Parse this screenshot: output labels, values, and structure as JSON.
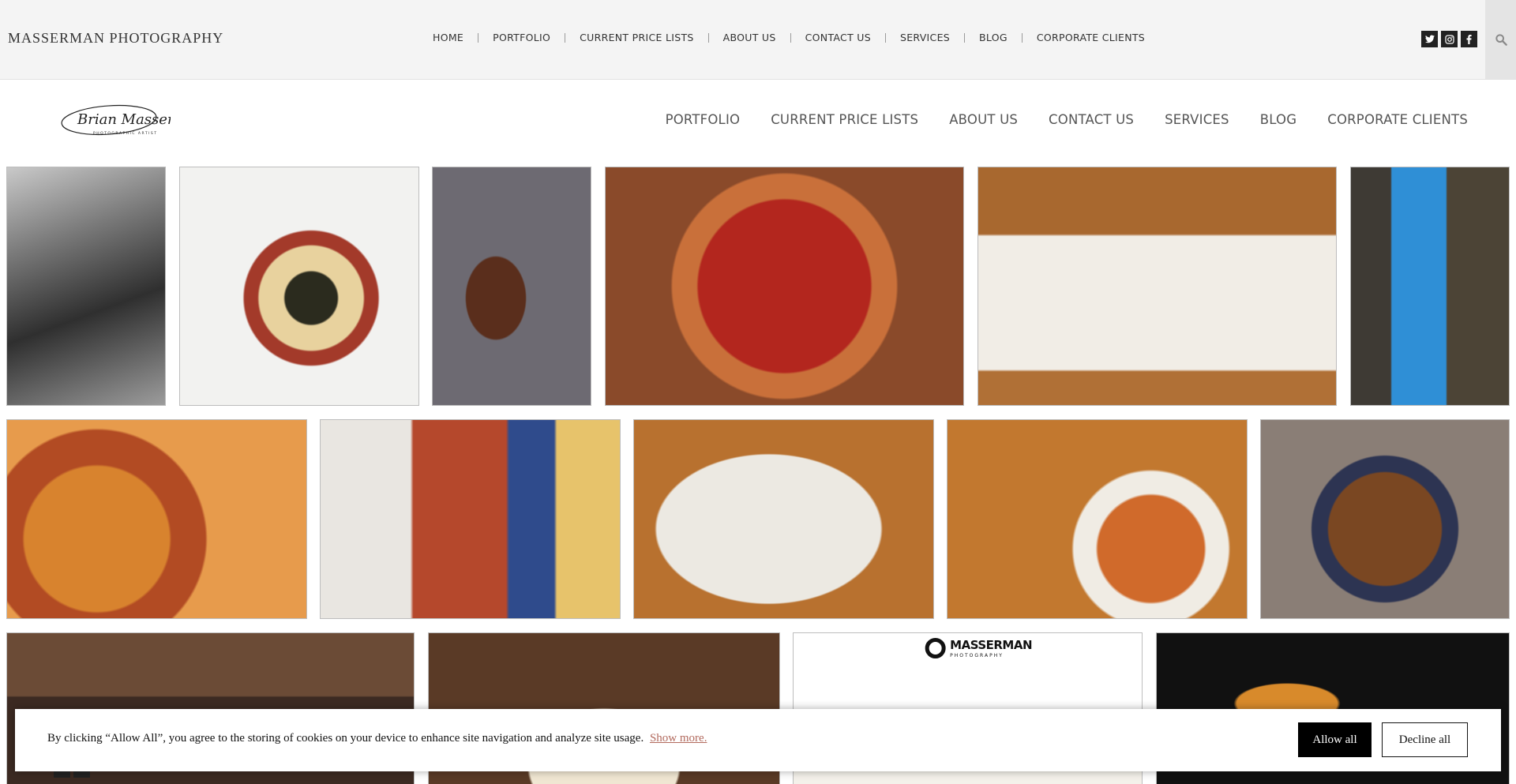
{
  "topbar": {
    "site_title": "MASSERMAN PHOTOGRAPHY",
    "nav": [
      "HOME",
      "PORTFOLIO",
      "CURRENT PRICE LISTS",
      "ABOUT US",
      "CONTACT US",
      "SERVICES",
      "BLOG",
      "CORPORATE CLIENTS"
    ],
    "socials": [
      {
        "icon": "twitter-icon",
        "glyph": "t"
      },
      {
        "icon": "instagram-icon",
        "glyph": "◻"
      },
      {
        "icon": "facebook-icon",
        "glyph": "f"
      }
    ],
    "search_icon": "search-icon"
  },
  "header": {
    "logo_script": "Brian Masserman",
    "logo_sub": "PHOTOGRAPHIC ARTIST",
    "nav": [
      "PORTFOLIO",
      "CURRENT PRICE LISTS",
      "ABOUT US",
      "CONTACT US",
      "SERVICES",
      "BLOG",
      "CORPORATE CLIENTS"
    ]
  },
  "gallery": [
    {
      "name": "photo-portrait-dreadlocks",
      "bg": "linear-gradient(160deg,#c9c9c9 0%,#7a7a7a 30%,#2f2f2f 60%,#9c9c9c 100%)"
    },
    {
      "name": "photo-plated-beet-dish",
      "bg": "radial-gradient(circle at 55% 55%,#2b2b1e 0 14%,#e8d29e 15% 28%,#a33a2a 29% 36%,#f2f2f0 37% 100%)"
    },
    {
      "name": "photo-tomahawk-steak",
      "bg": "radial-gradient(ellipse at 40% 55%,#5a2e1c 0 22%,#6d6a72 23% 100%)"
    },
    {
      "name": "photo-pizza-topdown",
      "bg": "radial-gradient(circle at 50% 50%,#b3261e 0 40%,#c9703a 41% 52%,#8a4a2a 53% 100%)"
    },
    {
      "name": "photo-salmon-plate",
      "bg": "linear-gradient(180deg,#a8682f 0 28%,#f1ede6 29% 85%,#b07036 86% 100%)"
    },
    {
      "name": "photo-pontoon-ale-can",
      "bg": "linear-gradient(90deg,#3e3a34 0 25%,#2f8fd6 26% 60%,#4c4436 61% 100%)"
    },
    {
      "name": "photo-two-pizzas-salad",
      "bg": "radial-gradient(circle at 30% 60%,#d8832e 0 30%,#b24b23 31% 45%,#e79b4c 46% 100%)"
    },
    {
      "name": "photo-fish-tacos-chips",
      "bg": "linear-gradient(90deg,#e9e6e1 0 30%,#b5482c 31% 62%,#2f4b8c 63% 78%,#e7c36b 79% 100%)"
    },
    {
      "name": "photo-tacos-rice",
      "bg": "radial-gradient(ellipse at 45% 55%,#ece9e2 0 48%,#b8712f 49% 100%)"
    },
    {
      "name": "photo-shrimp-pasta-spread",
      "bg": "radial-gradient(circle at 68% 65%,#d06a2b 0 22%,#f0ece4 23% 32%,#c2782f 33% 100%)"
    },
    {
      "name": "photo-chili-bowl",
      "bg": "radial-gradient(circle at 50% 55%,#7a4722 0 34%,#2d3452 35% 44%,#8a7e76 45% 100%)"
    },
    {
      "name": "photo-noodle-dishes",
      "bg": "linear-gradient(180deg,#6b4b36 0 40%,#3c2a22 41% 100%)"
    },
    {
      "name": "photo-carrot-cake",
      "bg": "radial-gradient(ellipse at 50% 85%,#f0e6d2 0 30%,#5a3a26 31% 100%)"
    },
    {
      "name": "photo-branded-dessert",
      "bg": "linear-gradient(180deg,#ffffff 0 55%,#e0a13a 56% 75%,#f4f1ea 76% 100%)",
      "brand": true,
      "brand_text": "MASSERMAN",
      "brand_sub": "PHOTOGRAPHY"
    },
    {
      "name": "photo-cocktail-dark",
      "bg": "radial-gradient(ellipse at 37% 45%,#d88a2b 0 16%,#111111 17% 100%)"
    }
  ],
  "cookie": {
    "message": "By clicking “Allow All”, you agree to the storing of cookies on your device to enhance site navigation and analyze site usage.",
    "show_more": "Show more.",
    "allow_label": "Allow all",
    "decline_label": "Decline all"
  }
}
